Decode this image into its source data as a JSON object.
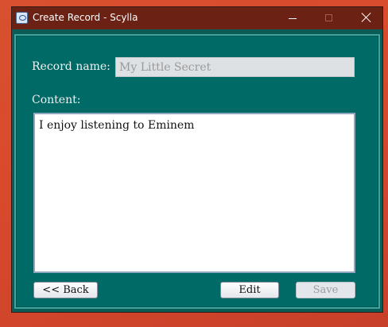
{
  "window": {
    "title": "Create Record - Scylla",
    "icon": "app-icon",
    "controls": [
      "minimize-icon",
      "maximize-icon",
      "close-icon"
    ]
  },
  "form": {
    "record_name_label": "Record name:",
    "record_name_placeholder": "My Little Secret",
    "record_name_value": "",
    "content_label": "Content:",
    "content_value": "I enjoy listening to Eminem"
  },
  "buttons": {
    "back": "<< Back",
    "edit": "Edit",
    "save": "Save",
    "save_enabled": false
  },
  "colors": {
    "titlebar": "#6b2113",
    "panel": "#006a66",
    "panel_border": "#3fa39d",
    "background": "#d8502f"
  }
}
